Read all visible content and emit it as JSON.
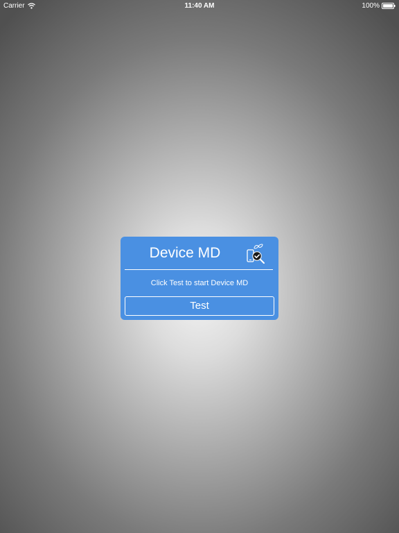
{
  "status_bar": {
    "carrier": "Carrier",
    "time": "11:40 AM",
    "battery": "100%",
    "icons": [
      "wifi-icon",
      "battery-icon"
    ]
  },
  "card": {
    "title": "Device MD",
    "app_icon": "phone-magnifier-check-icon",
    "instruction": "Click Test to start Device MD",
    "button_label": "Test",
    "accent_color": "#4a90e2"
  }
}
